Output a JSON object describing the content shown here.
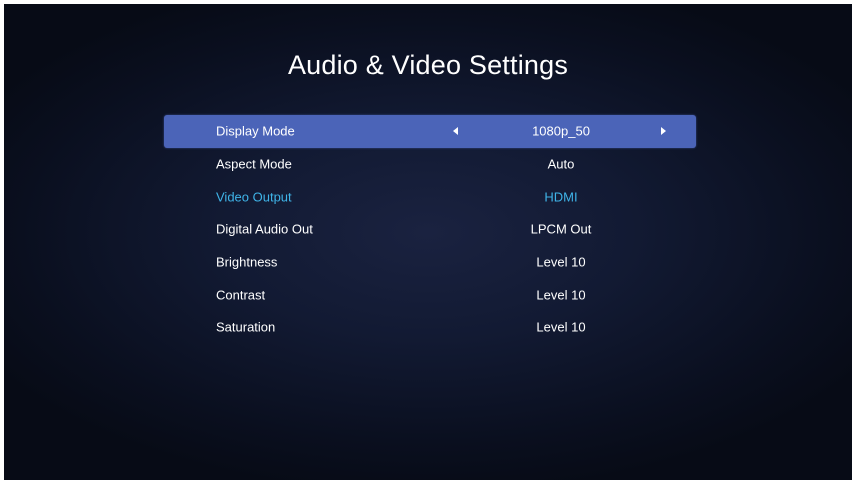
{
  "title": "Audio & Video Settings",
  "settings": [
    {
      "label": "Display Mode",
      "value": "1080p_50"
    },
    {
      "label": "Aspect Mode",
      "value": "Auto"
    },
    {
      "label": "Video Output",
      "value": "HDMI"
    },
    {
      "label": "Digital Audio Out",
      "value": "LPCM Out"
    },
    {
      "label": "Brightness",
      "value": "Level 10"
    },
    {
      "label": "Contrast",
      "value": "Level 10"
    },
    {
      "label": "Saturation",
      "value": "Level 10"
    }
  ],
  "icons": {
    "prev": "triangle-left-icon",
    "next": "triangle-right-icon"
  },
  "colors": {
    "selected_row": "#4b64b8",
    "highlight_text": "#3fb4e8",
    "text": "#ffffff"
  }
}
